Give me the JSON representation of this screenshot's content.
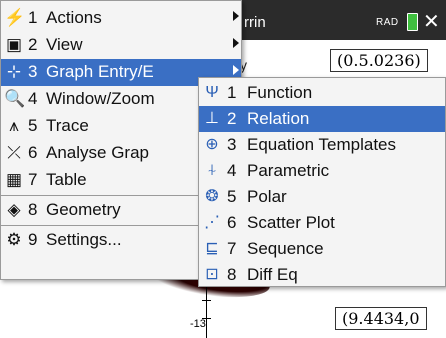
{
  "graph": {
    "title_partial": "rrin",
    "angle_mode": "RAD",
    "coord_top": "(0.5.0236)",
    "coord_bottom": "(9.4434,0",
    "axis_label": "-13",
    "menu_overlap_text": "y"
  },
  "menu": {
    "items": [
      {
        "number": "1",
        "label": "Actions",
        "icon": "lightning-icon",
        "glyph": "⚡",
        "submenu": true
      },
      {
        "number": "2",
        "label": "View",
        "icon": "view-icon",
        "glyph": "▣",
        "submenu": true
      },
      {
        "number": "3",
        "label": "Graph Entry/E",
        "icon": "graph-entry-icon",
        "glyph": "⊹",
        "submenu": true,
        "selected": true
      },
      {
        "number": "4",
        "label": "Window/Zoom",
        "icon": "zoom-icon",
        "glyph": "🔍",
        "submenu": true
      },
      {
        "number": "5",
        "label": "Trace",
        "icon": "trace-icon",
        "glyph": "⩚",
        "submenu": true
      },
      {
        "number": "6",
        "label": "Analyse Grap",
        "icon": "analyse-icon",
        "glyph": "⤫",
        "submenu": true
      },
      {
        "number": "7",
        "label": "Table",
        "icon": "table-icon",
        "glyph": "▦",
        "submenu": true
      },
      {
        "number": "8",
        "label": "Geometry",
        "icon": "geometry-icon",
        "glyph": "◈",
        "submenu": true
      },
      {
        "number": "9",
        "label": "Settings...",
        "icon": "gear-icon",
        "glyph": "⚙",
        "submenu": false
      }
    ]
  },
  "submenu": {
    "items": [
      {
        "number": "1",
        "label": "Function",
        "icon": "function-icon",
        "glyph": "Ψ"
      },
      {
        "number": "2",
        "label": "Relation",
        "icon": "relation-icon",
        "glyph": "⊥",
        "selected": true
      },
      {
        "number": "3",
        "label": "Equation Templates",
        "icon": "equation-templates-icon",
        "glyph": "⊕"
      },
      {
        "number": "4",
        "label": "Parametric",
        "icon": "parametric-icon",
        "glyph": "⍭"
      },
      {
        "number": "5",
        "label": "Polar",
        "icon": "polar-icon",
        "glyph": "❂"
      },
      {
        "number": "6",
        "label": "Scatter Plot",
        "icon": "scatter-plot-icon",
        "glyph": "⋰"
      },
      {
        "number": "7",
        "label": "Sequence",
        "icon": "sequence-icon",
        "glyph": "⊑"
      },
      {
        "number": "8",
        "label": "Diff Eq",
        "icon": "diff-eq-icon",
        "glyph": "⊡"
      }
    ]
  }
}
